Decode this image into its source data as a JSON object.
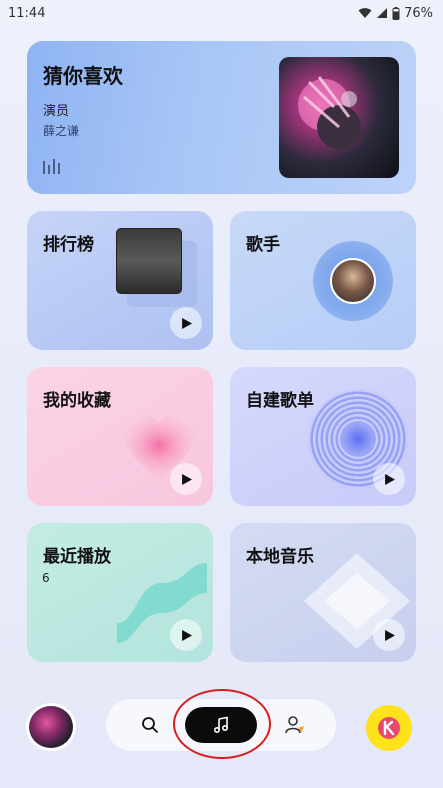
{
  "status": {
    "time": "11:44",
    "battery": "76%"
  },
  "hero": {
    "title": "猜你喜欢",
    "song": "演员",
    "artist": "薛之谦"
  },
  "cards": {
    "rank": {
      "title": "排行榜"
    },
    "singer": {
      "title": "歌手"
    },
    "favorites": {
      "title": "我的收藏"
    },
    "playlist": {
      "title": "自建歌单"
    },
    "recent": {
      "title": "最近播放",
      "count": "6"
    },
    "local": {
      "title": "本地音乐"
    }
  },
  "nav": {
    "items": [
      "search-icon",
      "music-note-icon",
      "profile-icon"
    ],
    "active": "music-note-icon"
  },
  "colors": {
    "accent_dark": "#0b0b0b",
    "highlight_ring": "#d61f1f",
    "k_badge": "#ffe21a"
  }
}
